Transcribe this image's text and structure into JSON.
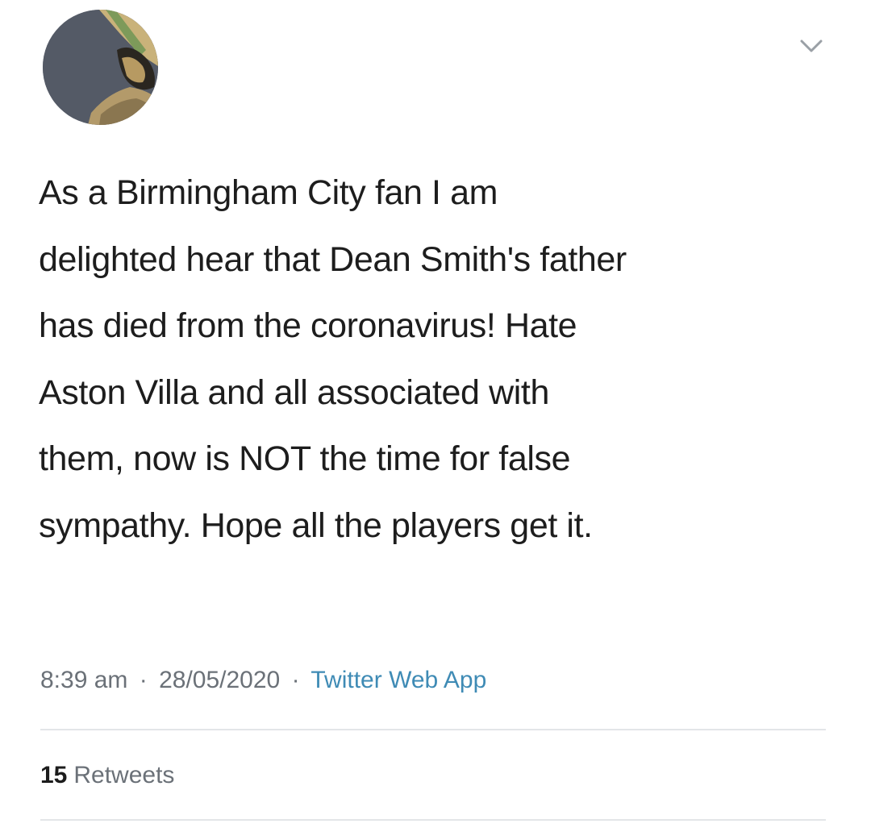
{
  "tweet": {
    "avatar_icon": "profile-avatar-icon",
    "menu_icon": "chevron-down-icon",
    "text_lines": [
      "As a Birmingham City fan I am",
      "delighted hear that Dean Smith's father",
      "has died from the coronavirus! Hate",
      "Aston Villa and all associated with",
      "them, now is NOT the time for false",
      "sympathy. Hope all the players get it."
    ],
    "time": "8:39 am",
    "separator": "·",
    "date": "28/05/2020",
    "source": "Twitter Web App",
    "retweet_count": "15",
    "retweet_label": "Retweets"
  },
  "colors": {
    "text": "#1d1d1d",
    "meta": "#6b7178",
    "source_link": "#3f8bb5",
    "divider": "#e3e5e8",
    "avatar_bg": "#545a66"
  }
}
